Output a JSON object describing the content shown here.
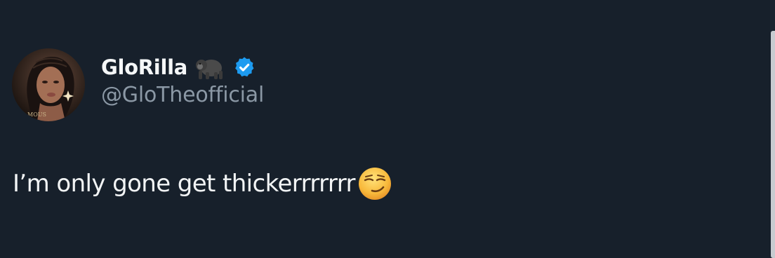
{
  "theme": {
    "background": "#17202b",
    "text_primary": "#f2f4f5",
    "text_secondary": "#8b98a5",
    "verified_blue": "#1d9bf0"
  },
  "tweet": {
    "author": {
      "display_name": "GloRilla",
      "name_emoji": "gorilla-emoji",
      "verified": true,
      "verified_icon": "verified-badge-icon",
      "handle": "@GloTheofficial",
      "avatar_text": "MOUS"
    },
    "text": "I’m only gone get thickerrrrrrr",
    "text_emoji": "smirking-face-emoji"
  }
}
